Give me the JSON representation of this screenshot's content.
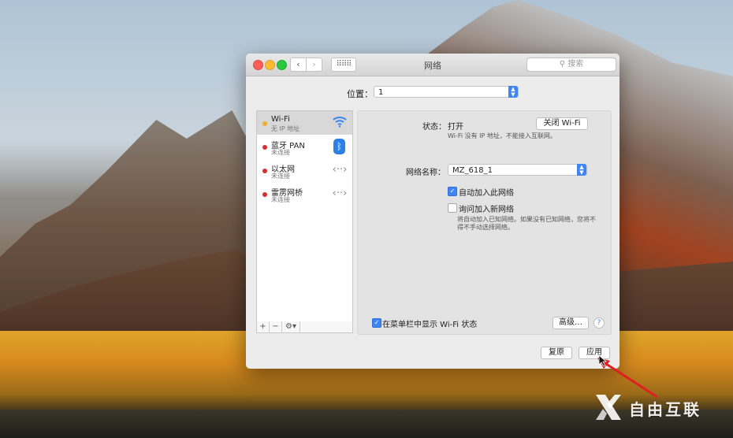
{
  "window": {
    "title": "网络",
    "search_placeholder": "搜索",
    "nav_back": "‹",
    "nav_forward": "›",
    "grid_glyph": "⠿⠿⠿"
  },
  "location": {
    "label": "位置：",
    "value": "1"
  },
  "services": [
    {
      "name": "Wi-Fi",
      "status": "无 IP 地址",
      "dot_color": "#f0ad2e",
      "icon": "wifi-icon",
      "selected": true
    },
    {
      "name": "蓝牙 PAN",
      "status": "未连接",
      "dot_color": "#d62d2d",
      "icon": "bluetooth-icon",
      "selected": false
    },
    {
      "name": "以太网",
      "status": "未连接",
      "dot_color": "#d62d2d",
      "icon": "ethernet-icon",
      "selected": false
    },
    {
      "name": "雷雳网桥",
      "status": "未连接",
      "dot_color": "#d62d2d",
      "icon": "thunderbolt-bridge-icon",
      "selected": false
    }
  ],
  "list_toolbar": {
    "add": "+",
    "remove": "−",
    "gear": "⚙▾"
  },
  "detail": {
    "status_label": "状态：",
    "status_value": "打开",
    "turn_off_wifi": "关闭 Wi-Fi",
    "status_desc": "Wi-Fi 没有 IP 地址，不能接入互联网。",
    "network_name_label": "网络名称：",
    "network_name_value": "MZ_618_1",
    "auto_join_label": "自动加入此网络",
    "auto_join_checked": true,
    "ask_join_label": "询问加入新网络",
    "ask_join_checked": false,
    "ask_join_note": "将自动加入已知网络。如果没有已知网络，您将不得不手动选择网络。",
    "show_menu_label": "在菜单栏中显示 Wi-Fi 状态",
    "show_menu_checked": true,
    "advanced": "高级…",
    "help": "?"
  },
  "footer": {
    "revert": "复原",
    "apply": "应用"
  },
  "watermark": {
    "text": "自由互联"
  },
  "colors": {
    "accent": "#3f84f5",
    "annotation_arrow": "#e02020"
  }
}
